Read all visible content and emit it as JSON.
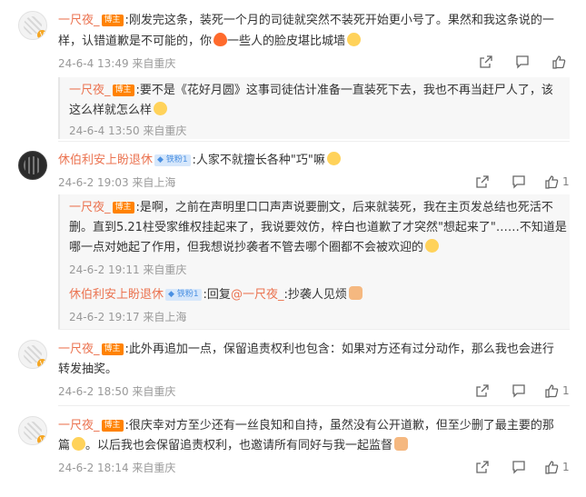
{
  "comments": [
    {
      "user": "一尺夜_",
      "badge": "博主",
      "text_lines": [
        ":刚发完这条，装死一个月的司徒就突然不装死开始更小号了。果然和我这条说的一",
        "样，认错道歉是不可能的，你",
        "一些人的脸皮堪比城墙"
      ],
      "time": "24-6-4 13:49 来自重庆",
      "reply": {
        "user": "一尺夜_",
        "badge": "博主",
        "text_lines": [
          ":要不是《花好月圆》这事司徒估计准备一直装死下去，我也不再当赶尸人了，该",
          "这么样就怎么样"
        ],
        "time": "24-6-4 13:50 来自重庆"
      }
    },
    {
      "user": "休伯利安上盼退休",
      "badge": "铁粉1",
      "text": ":人家不就擅长各种\"巧\"嘛",
      "time": "24-6-2 19:03 来自上海",
      "like_count": "1",
      "replies": [
        {
          "user": "一尺夜_",
          "badge": "博主",
          "text_lines": [
            ":是啊，之前在声明里口口声声说要删文，后来就装死，我在主页发总结也死活不",
            "删。直到5.21柱受家维权挂起来了，我说要效仿，梓白也道歉了才突然\"想起来了\"……不知道是",
            "哪一点对她起了作用，但我想说抄袭者不管去哪个圈都不会被欢迎的"
          ],
          "time": "24-6-2 19:11 来自重庆"
        },
        {
          "user": "休伯利安上盼退休",
          "badge": "铁粉1",
          "text_prefix": ":回复",
          "mention": "@一尺夜_",
          "text_suffix": ":抄袭人见烦",
          "time": "24-6-2 19:17 来自上海"
        }
      ]
    },
    {
      "user": "一尺夜_",
      "badge": "博主",
      "text_lines": [
        ":此外再追加一点，保留追责权利也包含：如果对方还有过分动作，那么我也会进行",
        "转发抽奖。"
      ],
      "time": "24-6-2 18:50 来自重庆",
      "like_count": "1"
    },
    {
      "user": "一尺夜_",
      "badge": "博主",
      "text_lines": [
        ":很庆幸对方至少还有一丝良知和自持，虽然没有公开道歉，但至少删了最主要的那",
        "篇",
        "。以后我也会保留追责权利，也邀请所有同好与我一起监督"
      ],
      "time": "24-6-2 18:14 来自重庆",
      "like_count": "1"
    }
  ],
  "icons": {
    "share": "share-icon",
    "comment": "comment-icon",
    "like": "thumbs-up-icon"
  },
  "colors": {
    "username": "#eb7350",
    "meta": "#999999",
    "badge_bg": "#ff8200",
    "fans_badge": "#4a90e2",
    "reply_bg": "#f7f7f7"
  }
}
